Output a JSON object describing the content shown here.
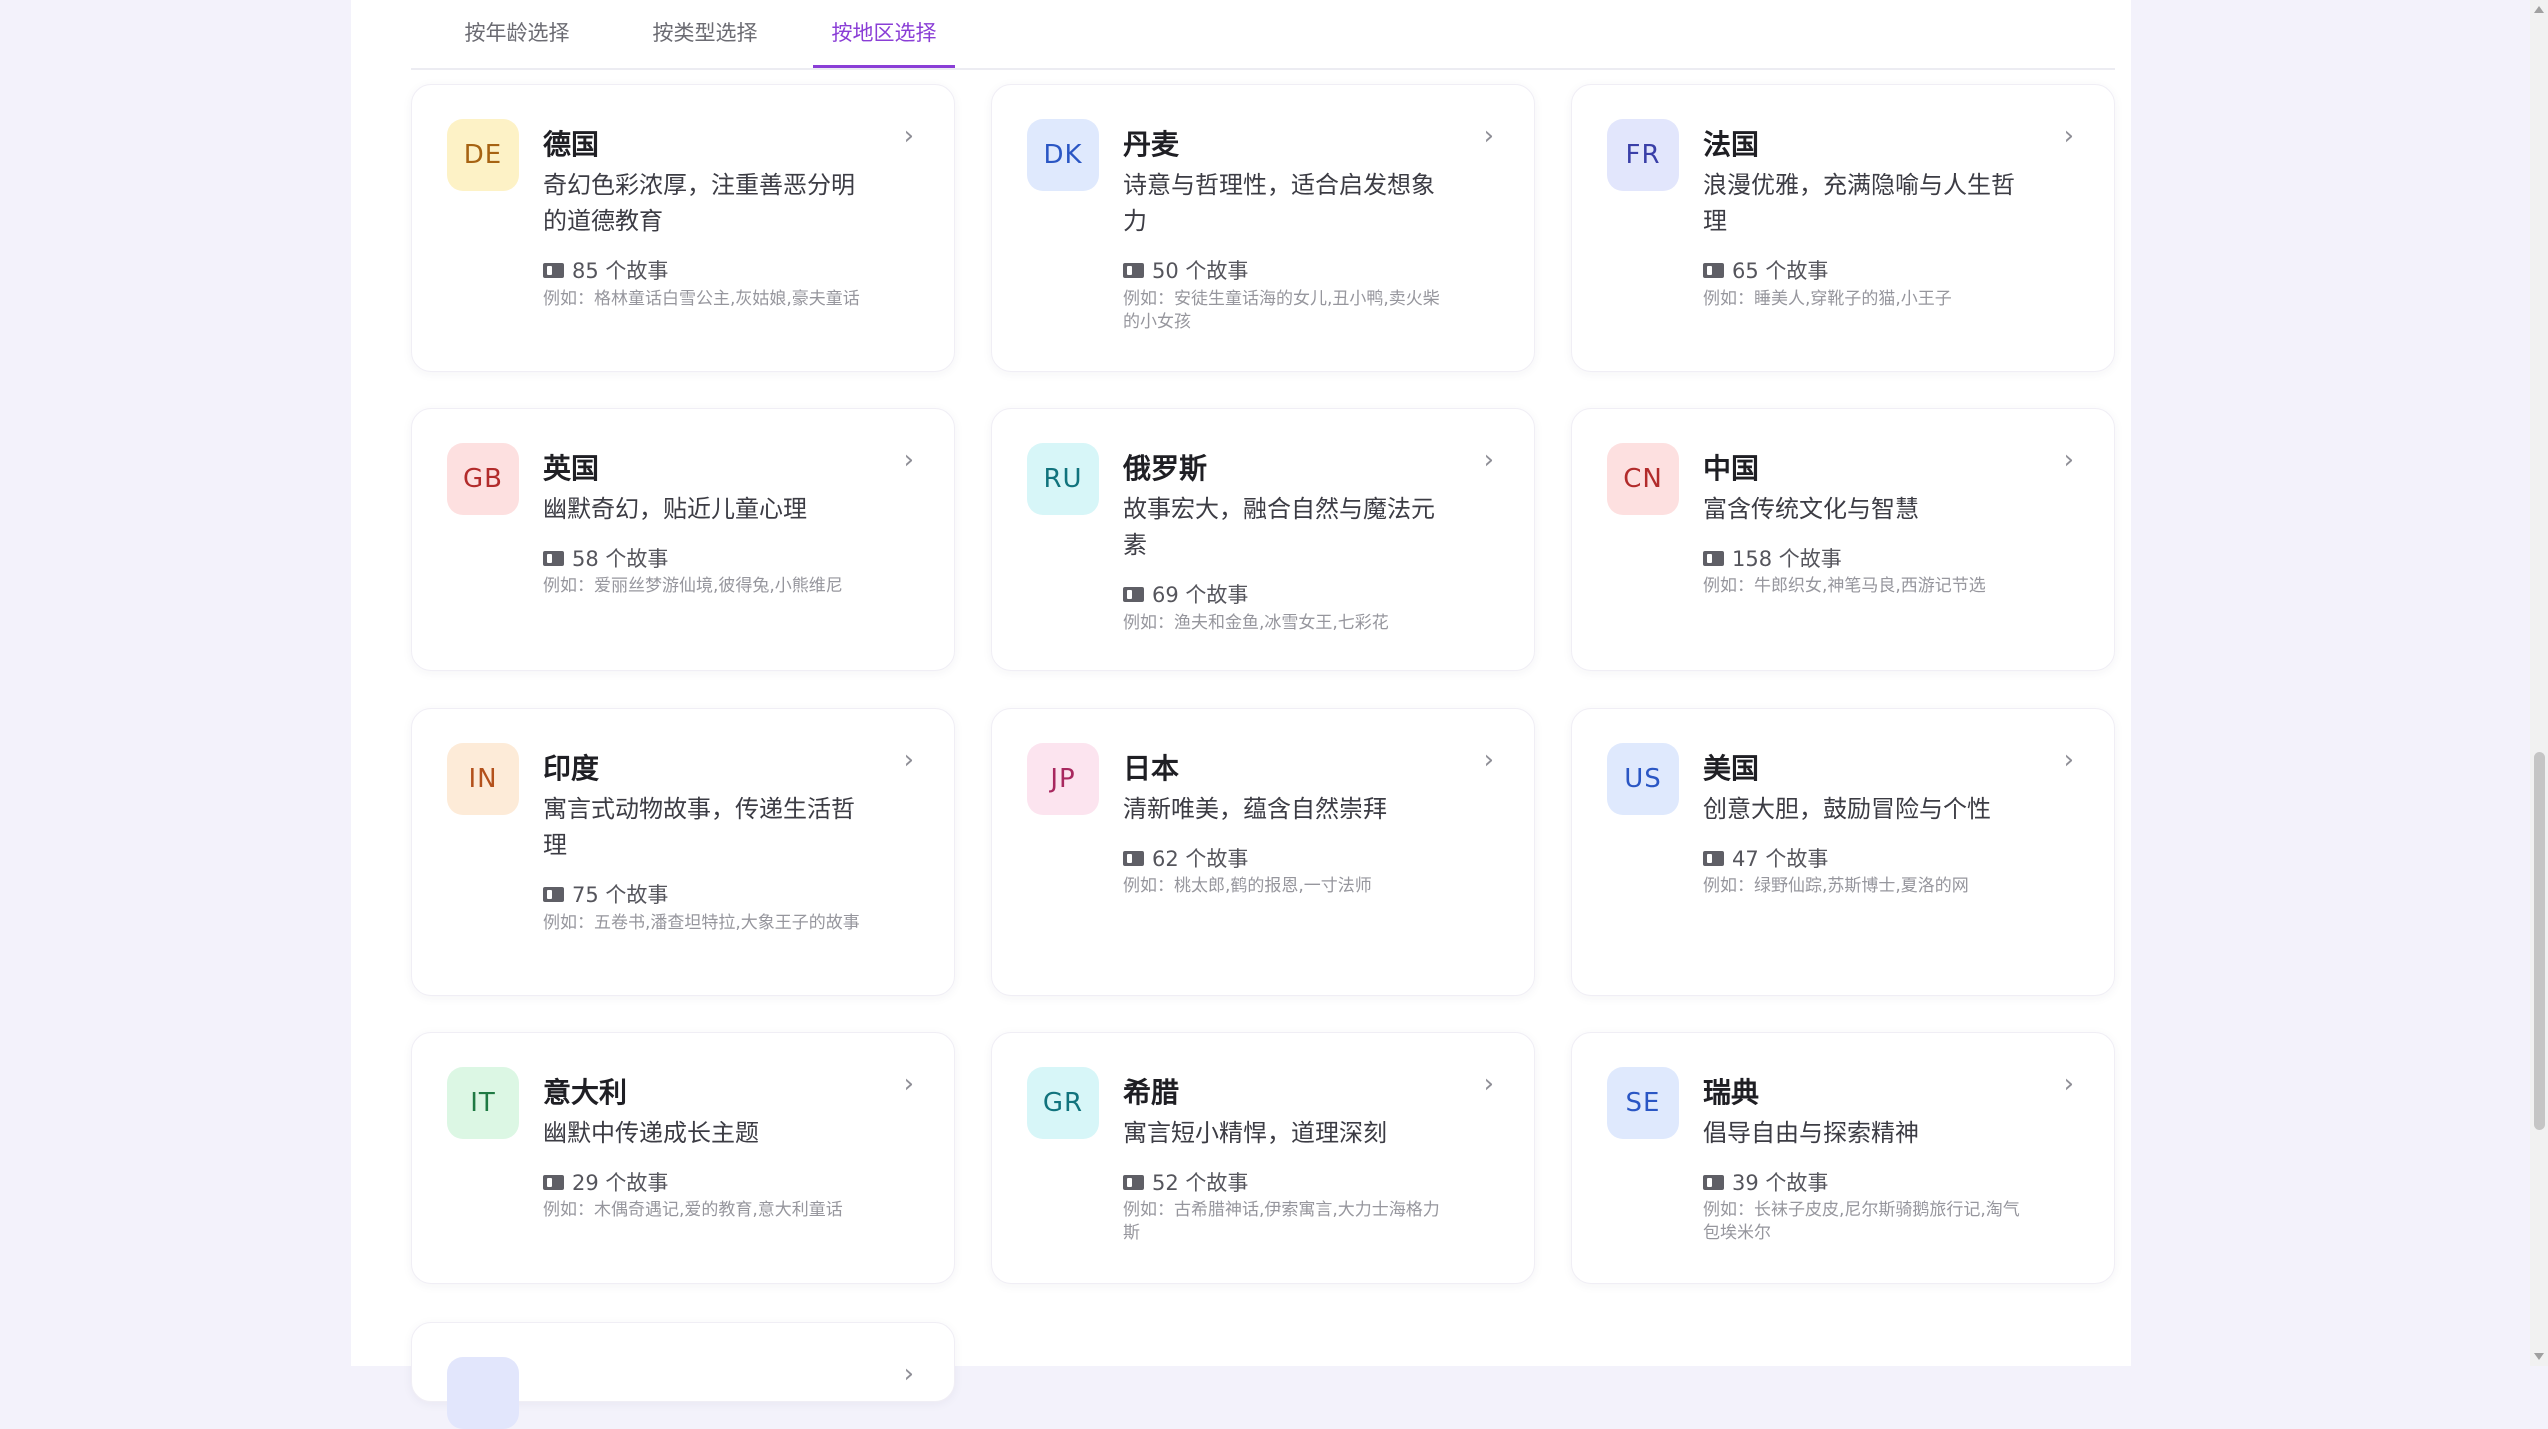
{
  "tabs": [
    {
      "label": "按年龄选择"
    },
    {
      "label": "按类型选择"
    },
    {
      "label": "按地区选择"
    }
  ],
  "countries": [
    {
      "code": "DE",
      "name": "德国",
      "desc": "奇幻色彩浓厚，注重善恶分明的道德教育",
      "count": "85 个故事",
      "example": "例如：格林童话白雪公主,灰姑娘,豪夫童话",
      "badge_bg": "#fdf2c6",
      "badge_fg": "#a66312"
    },
    {
      "code": "DK",
      "name": "丹麦",
      "desc": "诗意与哲理性，适合启发想象力",
      "count": "50 个故事",
      "example": "例如：安徒生童话海的女儿,丑小鸭,卖火柴的小女孩",
      "badge_bg": "#dfe9fd",
      "badge_fg": "#2a56c4"
    },
    {
      "code": "FR",
      "name": "法国",
      "desc": "浪漫优雅，充满隐喻与人生哲理",
      "count": "65 个故事",
      "example": "例如：睡美人,穿靴子的猫,小王子",
      "badge_bg": "#e2e6fc",
      "badge_fg": "#3a3fa8"
    },
    {
      "code": "GB",
      "name": "英国",
      "desc": "幽默奇幻，贴近儿童心理",
      "count": "58 个故事",
      "example": "例如：爱丽丝梦游仙境,彼得兔,小熊维尼",
      "badge_bg": "#fde0e0",
      "badge_fg": "#b22b2b"
    },
    {
      "code": "RU",
      "name": "俄罗斯",
      "desc": "故事宏大，融合自然与魔法元素",
      "count": "69 个故事",
      "example": "例如：渔夫和金鱼,冰雪女王,七彩花",
      "badge_bg": "#d7f6f8",
      "badge_fg": "#11737d"
    },
    {
      "code": "CN",
      "name": "中国",
      "desc": "富含传统文化与智慧",
      "count": "158 个故事",
      "example": "例如：牛郎织女,神笔马良,西游记节选",
      "badge_bg": "#fde0e0",
      "badge_fg": "#b22b2b"
    },
    {
      "code": "IN",
      "name": "印度",
      "desc": "寓言式动物故事，传递生活哲理",
      "count": "75 个故事",
      "example": "例如：五卷书,潘查坦特拉,大象王子的故事",
      "badge_bg": "#fdebd8",
      "badge_fg": "#b3511c"
    },
    {
      "code": "JP",
      "name": "日本",
      "desc": "清新唯美，蕴含自然崇拜",
      "count": "62 个故事",
      "example": "例如：桃太郎,鹤的报恩,一寸法师",
      "badge_bg": "#fce4ef",
      "badge_fg": "#a8285f"
    },
    {
      "code": "US",
      "name": "美国",
      "desc": "创意大胆，鼓励冒险与个性",
      "count": "47 个故事",
      "example": "例如：绿野仙踪,苏斯博士,夏洛的网",
      "badge_bg": "#dfe9fd",
      "badge_fg": "#2a56c4"
    },
    {
      "code": "IT",
      "name": "意大利",
      "desc": "幽默中传递成长主题",
      "count": "29 个故事",
      "example": "例如：木偶奇遇记,爱的教育,意大利童话",
      "badge_bg": "#dcf7e4",
      "badge_fg": "#1f7a43"
    },
    {
      "code": "GR",
      "name": "希腊",
      "desc": "寓言短小精悍，道理深刻",
      "count": "52 个故事",
      "example": "例如：古希腊神话,伊索寓言,大力士海格力斯",
      "badge_bg": "#d7f6f8",
      "badge_fg": "#11737d"
    },
    {
      "code": "SE",
      "name": "瑞典",
      "desc": "倡导自由与探索精神",
      "count": "39 个故事",
      "example": "例如：长袜子皮皮,尼尔斯骑鹅旅行记,淘气包埃米尔",
      "badge_bg": "#dfe9fd",
      "badge_fg": "#2a56c4"
    }
  ]
}
